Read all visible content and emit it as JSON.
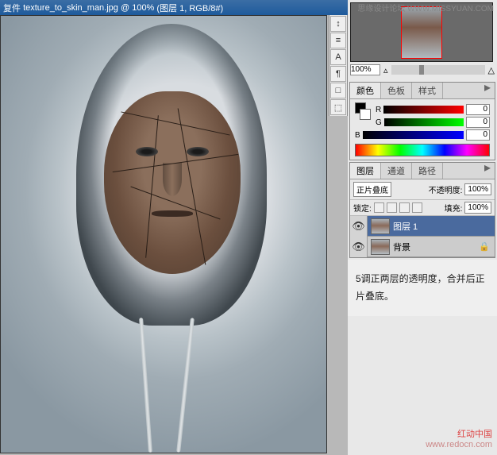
{
  "titlebar": {
    "prefix": "复件",
    "filename": "texture_to_skin_man.jpg",
    "zoom": "100%",
    "layer_info": "(图层 1, RGB/8#)"
  },
  "watermarks": {
    "top": "思缘设计论坛  WWW.MISSYUAN.COM",
    "bottom1": "红动中国",
    "bottom2": "www.redocn.com"
  },
  "right_toolbar": {
    "items": [
      "↕",
      "≡",
      "A",
      "¶",
      "□",
      "⬚"
    ]
  },
  "navigator": {
    "zoom": "100%"
  },
  "color_panel": {
    "tabs": [
      "颜色",
      "色板",
      "样式"
    ],
    "channels": [
      {
        "label": "R",
        "value": "0"
      },
      {
        "label": "G",
        "value": "0"
      },
      {
        "label": "B",
        "value": "0"
      }
    ]
  },
  "layers_panel": {
    "tabs": [
      "图层",
      "通道",
      "路径"
    ],
    "blend_mode": "正片叠底",
    "opacity_label": "不透明度:",
    "opacity": "100%",
    "lock_label": "锁定:",
    "fill_label": "填充:",
    "fill": "100%",
    "layers": [
      {
        "name": "图层 1",
        "selected": true,
        "locked": false
      },
      {
        "name": "背景",
        "selected": false,
        "locked": true
      }
    ]
  },
  "explanation": {
    "text": "5调正两层的透明度，合并后正片叠底。"
  }
}
